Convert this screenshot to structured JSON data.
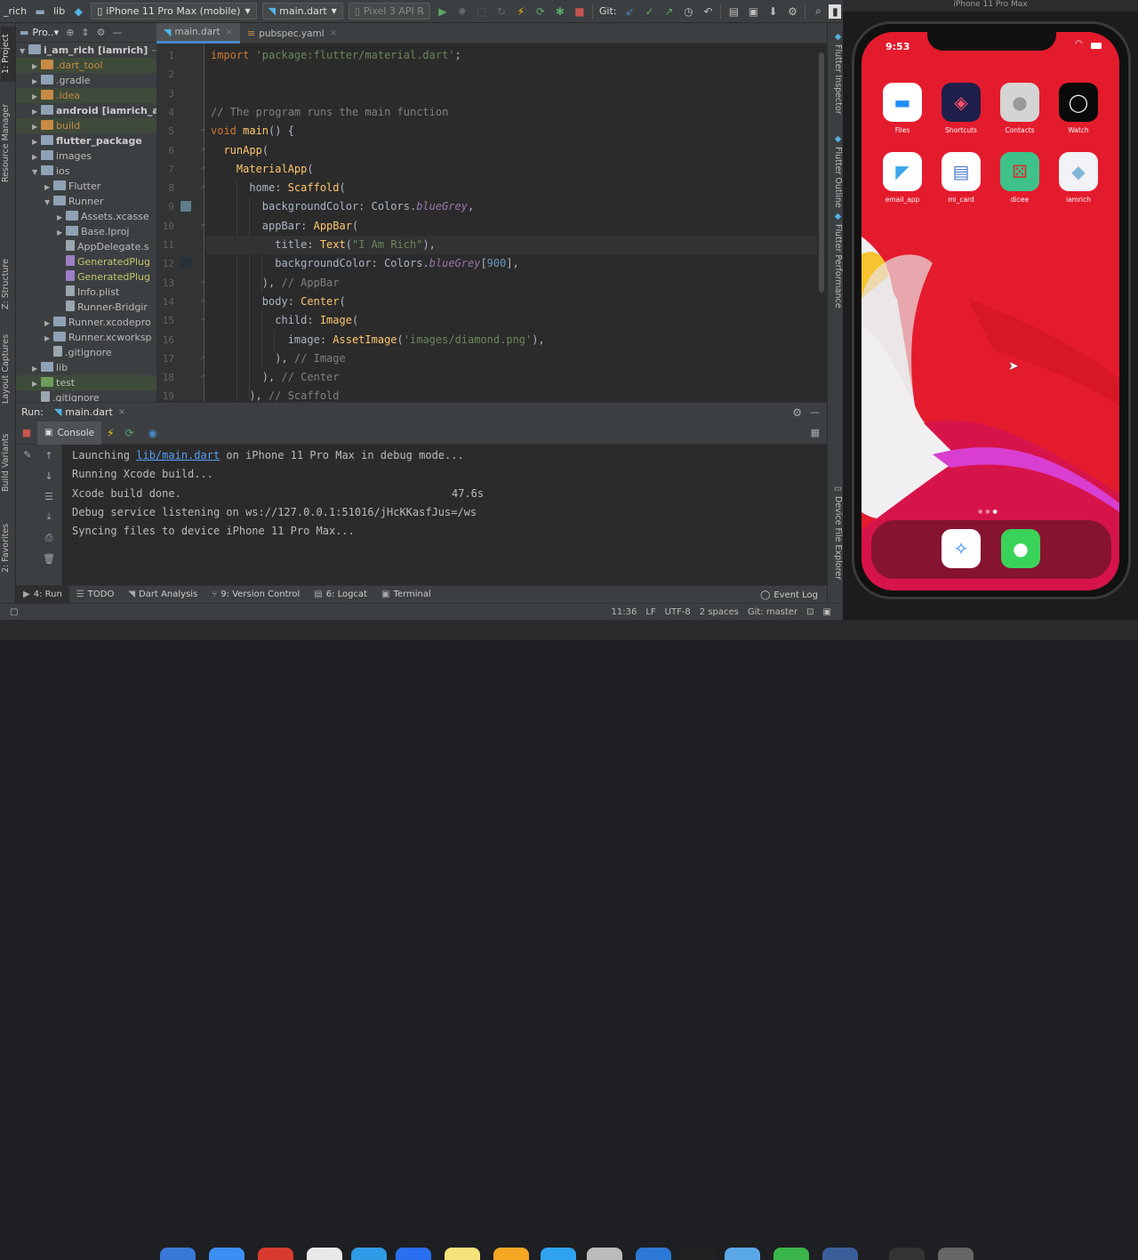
{
  "toolbar": {
    "project_name": "_rich",
    "lib_label": "lib",
    "device_selector": "iPhone 11 Pro Max (mobile)",
    "run_config": "main.dart",
    "emulator": "Pixel 3 API R",
    "git_label": "Git:"
  },
  "left_strip": {
    "project_tab": "1: Project",
    "resource_tab": "Resource Manager",
    "structure_tab": "Z: Structure",
    "layout_tab": "Layout Captures",
    "build_tab": "Build Variants",
    "favorites_tab": "2: Favorites"
  },
  "right_strip": {
    "inspector_tab": "Flutter Inspector",
    "outline_tab": "Flutter Outline",
    "performance_tab": "Flutter Performance",
    "device_tab": "Device File Explorer"
  },
  "project": {
    "header": "Pro..▾",
    "tree": [
      {
        "label": "i_am_rich [iamrich]",
        "suffix": " ~/d",
        "depth": 0,
        "arrow": "▼",
        "style": "bold",
        "icon": "folder-icon",
        "color": "#8fa2b6"
      },
      {
        "label": ".dart_tool",
        "depth": 1,
        "arrow": "▶",
        "style": "orange",
        "icon": "folder-icon",
        "color": "#c98a45",
        "hl": true
      },
      {
        "label": ".gradle",
        "depth": 1,
        "arrow": "▶",
        "style": "",
        "icon": "folder-icon",
        "color": "#8fa2b6"
      },
      {
        "label": ".idea",
        "depth": 1,
        "arrow": "▶",
        "style": "orange",
        "icon": "folder-icon",
        "color": "#c98a45",
        "hl": true
      },
      {
        "label": "android [iamrich_an",
        "depth": 1,
        "arrow": "▶",
        "style": "bold",
        "icon": "folder-icon",
        "color": "#8fa2b6"
      },
      {
        "label": "build",
        "depth": 1,
        "arrow": "▶",
        "style": "orange",
        "icon": "folder-icon",
        "color": "#c98a45",
        "hl": true
      },
      {
        "label": "flutter_package",
        "depth": 1,
        "arrow": "▶",
        "style": "bold",
        "icon": "folder-icon",
        "color": "#8fa2b6"
      },
      {
        "label": "images",
        "depth": 1,
        "arrow": "▶",
        "style": "",
        "icon": "folder-icon",
        "color": "#8fa2b6"
      },
      {
        "label": "ios",
        "depth": 1,
        "arrow": "▼",
        "style": "",
        "icon": "folder-icon",
        "color": "#8fa2b6"
      },
      {
        "label": "Flutter",
        "depth": 2,
        "arrow": "▶",
        "style": "",
        "icon": "folder-icon",
        "color": "#8fa2b6"
      },
      {
        "label": "Runner",
        "depth": 2,
        "arrow": "▼",
        "style": "",
        "icon": "folder-icon",
        "color": "#8fa2b6"
      },
      {
        "label": "Assets.xcasse",
        "depth": 3,
        "arrow": "▶",
        "style": "",
        "icon": "folder-icon",
        "color": "#8fa2b6"
      },
      {
        "label": "Base.lproj",
        "depth": 3,
        "arrow": "▶",
        "style": "",
        "icon": "folder-icon",
        "color": "#8fa2b6"
      },
      {
        "label": "AppDelegate.s",
        "depth": 3,
        "arrow": "",
        "style": "",
        "icon": "file-icon",
        "color": "#9aa7b0"
      },
      {
        "label": "GeneratedPlug",
        "depth": 3,
        "arrow": "",
        "style": "yellow",
        "icon": "file-icon",
        "color": "#9a7fc4"
      },
      {
        "label": "GeneratedPlug",
        "depth": 3,
        "arrow": "",
        "style": "yellow",
        "icon": "file-icon",
        "color": "#9a7fc4"
      },
      {
        "label": "Info.plist",
        "depth": 3,
        "arrow": "",
        "style": "",
        "icon": "file-icon",
        "color": "#9aa7b0"
      },
      {
        "label": "Runner-Bridgir",
        "depth": 3,
        "arrow": "",
        "style": "",
        "icon": "file-icon",
        "color": "#9aa7b0"
      },
      {
        "label": "Runner.xcodepro",
        "depth": 2,
        "arrow": "▶",
        "style": "",
        "icon": "folder-icon",
        "color": "#8fa2b6"
      },
      {
        "label": "Runner.xcworksp",
        "depth": 2,
        "arrow": "▶",
        "style": "",
        "icon": "folder-icon",
        "color": "#8fa2b6"
      },
      {
        "label": ".gitignore",
        "depth": 2,
        "arrow": "",
        "style": "",
        "icon": "file-icon",
        "color": "#9aa7b0"
      },
      {
        "label": "lib",
        "depth": 1,
        "arrow": "▶",
        "style": "",
        "icon": "folder-icon",
        "color": "#8fa2b6"
      },
      {
        "label": "test",
        "depth": 1,
        "arrow": "▶",
        "style": "",
        "icon": "folder-icon",
        "color": "#6f9b5a",
        "hl": true
      },
      {
        "label": ".gitignore",
        "depth": 1,
        "arrow": "",
        "style": "",
        "icon": "file-icon",
        "color": "#9aa7b0"
      }
    ]
  },
  "editor": {
    "tabs": [
      {
        "label": "main.dart",
        "active": true
      },
      {
        "label": "pubspec.yaml",
        "active": false
      }
    ],
    "line_numbers": [
      "1",
      "2",
      "3",
      "4",
      "5",
      "6",
      "7",
      "8",
      "9",
      "10",
      "11",
      "12",
      "13",
      "14",
      "15",
      "16",
      "17",
      "18",
      "19"
    ],
    "code_lines": [
      [
        [
          "kw",
          "import "
        ],
        [
          "str",
          "'package:flutter/material.dart'"
        ],
        [
          "",
          "; "
        ]
      ],
      [],
      [],
      [
        [
          "cmt",
          "// The program runs the main function"
        ]
      ],
      [
        [
          "kw",
          "void "
        ],
        [
          "fn",
          "main"
        ],
        [
          "",
          "() {"
        ]
      ],
      [
        [
          "",
          "  "
        ],
        [
          "fn",
          "runApp"
        ],
        [
          "",
          "("
        ]
      ],
      [
        [
          "",
          "    "
        ],
        [
          "cls",
          "MaterialApp"
        ],
        [
          "",
          "("
        ]
      ],
      [
        [
          "",
          "      home: "
        ],
        [
          "cls",
          "Scaffold"
        ],
        [
          "",
          "("
        ]
      ],
      [
        [
          "",
          "        backgroundColor: Colors."
        ],
        [
          "ital",
          "blueGrey"
        ],
        [
          "",
          ","
        ]
      ],
      [
        [
          "",
          "        appBar: "
        ],
        [
          "cls",
          "AppBar"
        ],
        [
          "",
          "("
        ]
      ],
      [
        [
          "",
          "          title: "
        ],
        [
          "cls",
          "Text"
        ],
        [
          "",
          "("
        ],
        [
          "str",
          "\"I Am Rich\""
        ],
        [
          "",
          "),"
        ]
      ],
      [
        [
          "",
          "          backgroundColor: Colors."
        ],
        [
          "ital",
          "blueGrey"
        ],
        [
          "",
          "["
        ],
        [
          "num",
          "900"
        ],
        [
          "",
          "],"
        ]
      ],
      [
        [
          "",
          "        ), "
        ],
        [
          "cmt",
          "// AppBar"
        ]
      ],
      [
        [
          "",
          "        body: "
        ],
        [
          "cls",
          "Center"
        ],
        [
          "",
          "("
        ]
      ],
      [
        [
          "",
          "          child: "
        ],
        [
          "cls",
          "Image"
        ],
        [
          "",
          "("
        ]
      ],
      [
        [
          "",
          "            image: "
        ],
        [
          "cls",
          "AssetImage"
        ],
        [
          "",
          "("
        ],
        [
          "str",
          "'images/diamond.png'"
        ],
        [
          "",
          "),"
        ]
      ],
      [
        [
          "",
          "          ), "
        ],
        [
          "cmt",
          "// Image"
        ]
      ],
      [
        [
          "",
          "        ), "
        ],
        [
          "cmt",
          "// Center"
        ]
      ],
      [
        [
          "",
          "      ), "
        ],
        [
          "cmt",
          "// Scaffold"
        ]
      ]
    ]
  },
  "run": {
    "label": "Run:",
    "tab": "main.dart",
    "console_tab": "Console",
    "console_lines": [
      {
        "pre": "Launching ",
        "link": "lib/main.dart",
        "post": " on iPhone 11 Pro Max in debug mode...",
        "time": ""
      },
      {
        "pre": "Running Xcode build...",
        "link": "",
        "post": "",
        "time": ""
      },
      {
        "pre": "Xcode build done.",
        "link": "",
        "post": "",
        "time": "47.6s"
      },
      {
        "pre": "Debug service listening on ws://127.0.0.1:51016/jHcKKasfJus=/ws",
        "link": "",
        "post": "",
        "time": ""
      },
      {
        "pre": "Syncing files to device iPhone 11 Pro Max...",
        "link": "",
        "post": "",
        "time": ""
      }
    ]
  },
  "bottom_tabs": {
    "run": "4: Run",
    "todo": "TODO",
    "dart_analysis": "Dart Analysis",
    "version_control": "9: Version Control",
    "logcat": "6: Logcat",
    "terminal": "Terminal",
    "event_log": "Event Log"
  },
  "status": {
    "position": "11:36",
    "line_sep": "LF",
    "encoding": "UTF-8",
    "indent": "2 spaces",
    "git": "Git: master"
  },
  "simulator": {
    "title": "iPhone 11 Pro Max",
    "time": "9:53",
    "apps_row1": [
      {
        "label": "Files",
        "icon": "files-icon",
        "bg": "#ffffff"
      },
      {
        "label": "Shortcuts",
        "icon": "shortcuts-icon",
        "bg": "#1e1f4a"
      },
      {
        "label": "Contacts",
        "icon": "contacts-icon",
        "bg": "#d4d4d4"
      },
      {
        "label": "Watch",
        "icon": "watch-icon",
        "bg": "#0a0a0a"
      }
    ],
    "apps_row2": [
      {
        "label": "email_app",
        "icon": "flutter-icon",
        "bg": "#ffffff"
      },
      {
        "label": "mi_card",
        "icon": "card-icon",
        "bg": "#ffffff"
      },
      {
        "label": "dicee",
        "icon": "dice-icon",
        "bg": "#3ec28a"
      },
      {
        "label": "iamrich",
        "icon": "diamond-icon",
        "bg": "#f2f2f7"
      }
    ],
    "dock_apps": [
      {
        "icon": "safari-icon",
        "bg": "#ffffff"
      },
      {
        "icon": "messages-icon",
        "bg": "#3ad35a"
      }
    ]
  }
}
